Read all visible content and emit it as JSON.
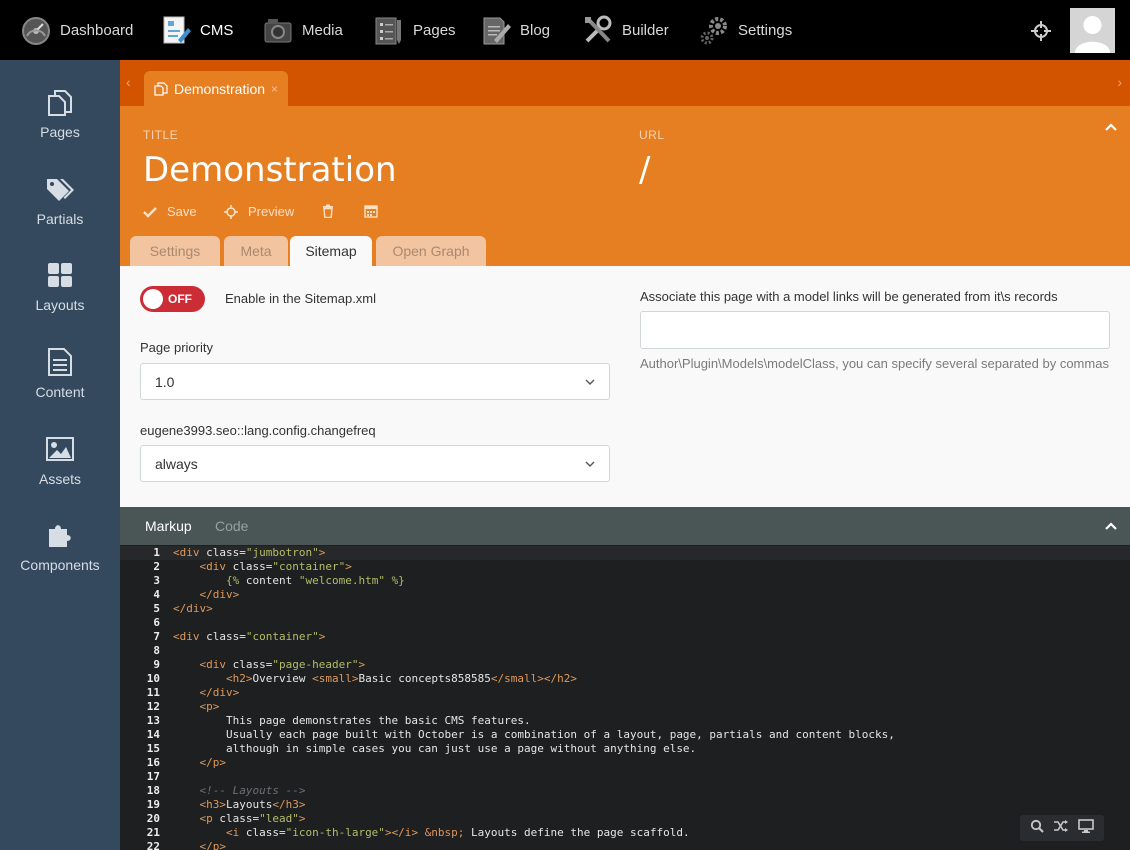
{
  "topnav": {
    "items": [
      {
        "label": "Dashboard",
        "icon": "dashboard-icon"
      },
      {
        "label": "CMS",
        "icon": "cms-icon"
      },
      {
        "label": "Media",
        "icon": "media-icon"
      },
      {
        "label": "Pages",
        "icon": "pages-checklist-icon"
      },
      {
        "label": "Blog",
        "icon": "blog-icon"
      },
      {
        "label": "Builder",
        "icon": "builder-icon"
      },
      {
        "label": "Settings",
        "icon": "settings-icon"
      }
    ],
    "active": "CMS"
  },
  "sidenav": {
    "items": [
      {
        "label": "Pages",
        "icon": "pages-icon"
      },
      {
        "label": "Partials",
        "icon": "partials-icon"
      },
      {
        "label": "Layouts",
        "icon": "layouts-icon"
      },
      {
        "label": "Content",
        "icon": "content-icon"
      },
      {
        "label": "Assets",
        "icon": "assets-icon"
      },
      {
        "label": "Components",
        "icon": "components-icon"
      }
    ]
  },
  "doc_tab": {
    "label": "Demonstration",
    "close": "×"
  },
  "header": {
    "title_label": "TITLE",
    "title_value": "Demonstration",
    "url_label": "URL",
    "url_value": "/",
    "toolbar": {
      "save": "Save",
      "preview": "Preview"
    },
    "subtabs": [
      "Settings",
      "Meta",
      "Sitemap",
      "Open Graph"
    ],
    "active_subtab": "Sitemap"
  },
  "sitemap": {
    "toggle_text": "OFF",
    "enable_label": "Enable in the Sitemap.xml",
    "priority_label": "Page priority",
    "priority_value": "1.0",
    "changefreq_label": "eugene3993.seo::lang.config.changefreq",
    "changefreq_value": "always",
    "model_label": "Associate this page with a model links will be generated from it\\s records",
    "model_value": "",
    "model_hint": "Author\\Plugin\\Models\\modelClass, you can specify several separated by commas"
  },
  "editor": {
    "tabs": [
      "Markup",
      "Code"
    ],
    "active_tab": "Markup",
    "lines": [
      "<div class=\"jumbotron\">",
      "    <div class=\"container\">",
      "        {% content \"welcome.htm\" %}",
      "    </div>",
      "</div>",
      "",
      "<div class=\"container\">",
      "",
      "    <div class=\"page-header\">",
      "        <h2>Overview <small>Basic concepts858585</small></h2>",
      "    </div>",
      "    <p>",
      "        This page demonstrates the basic CMS features.",
      "        Usually each page built with October is a combination of a layout, page, partials and content blocks,",
      "        although in simple cases you can just use a page without anything else.",
      "    </p>",
      "",
      "    <!-- Layouts -->",
      "    <h3>Layouts</h3>",
      "    <p class=\"lead\">",
      "        <i class=\"icon-th-large\"></i> &nbsp; Layouts define the page scaffold.",
      "    </p>"
    ]
  },
  "colors": {
    "topbar": "#000000",
    "sidebar": "#34495e",
    "tabstrip": "#d35400",
    "header": "#e67e22",
    "toggle_off": "#cb2c35",
    "editor_bg": "#1d1f21"
  }
}
